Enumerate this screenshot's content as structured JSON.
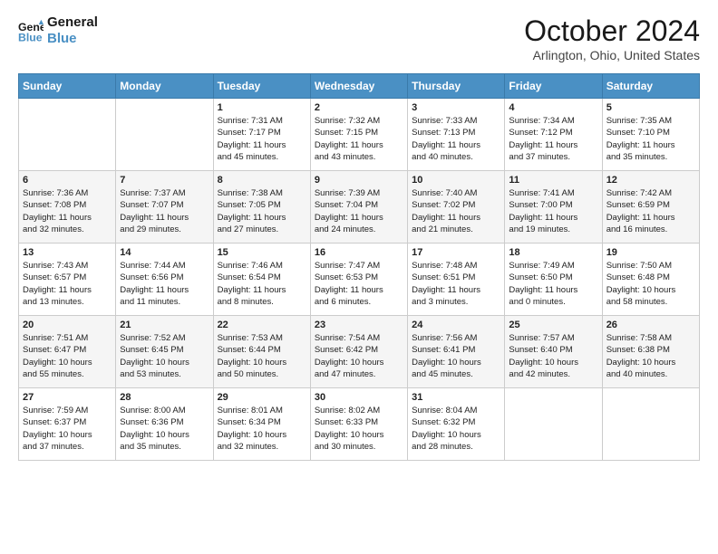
{
  "header": {
    "logo_line1": "General",
    "logo_line2": "Blue",
    "title": "October 2024",
    "location": "Arlington, Ohio, United States"
  },
  "days_of_week": [
    "Sunday",
    "Monday",
    "Tuesday",
    "Wednesday",
    "Thursday",
    "Friday",
    "Saturday"
  ],
  "weeks": [
    [
      {
        "day": "",
        "content": ""
      },
      {
        "day": "",
        "content": ""
      },
      {
        "day": "1",
        "content": "Sunrise: 7:31 AM\nSunset: 7:17 PM\nDaylight: 11 hours\nand 45 minutes."
      },
      {
        "day": "2",
        "content": "Sunrise: 7:32 AM\nSunset: 7:15 PM\nDaylight: 11 hours\nand 43 minutes."
      },
      {
        "day": "3",
        "content": "Sunrise: 7:33 AM\nSunset: 7:13 PM\nDaylight: 11 hours\nand 40 minutes."
      },
      {
        "day": "4",
        "content": "Sunrise: 7:34 AM\nSunset: 7:12 PM\nDaylight: 11 hours\nand 37 minutes."
      },
      {
        "day": "5",
        "content": "Sunrise: 7:35 AM\nSunset: 7:10 PM\nDaylight: 11 hours\nand 35 minutes."
      }
    ],
    [
      {
        "day": "6",
        "content": "Sunrise: 7:36 AM\nSunset: 7:08 PM\nDaylight: 11 hours\nand 32 minutes."
      },
      {
        "day": "7",
        "content": "Sunrise: 7:37 AM\nSunset: 7:07 PM\nDaylight: 11 hours\nand 29 minutes."
      },
      {
        "day": "8",
        "content": "Sunrise: 7:38 AM\nSunset: 7:05 PM\nDaylight: 11 hours\nand 27 minutes."
      },
      {
        "day": "9",
        "content": "Sunrise: 7:39 AM\nSunset: 7:04 PM\nDaylight: 11 hours\nand 24 minutes."
      },
      {
        "day": "10",
        "content": "Sunrise: 7:40 AM\nSunset: 7:02 PM\nDaylight: 11 hours\nand 21 minutes."
      },
      {
        "day": "11",
        "content": "Sunrise: 7:41 AM\nSunset: 7:00 PM\nDaylight: 11 hours\nand 19 minutes."
      },
      {
        "day": "12",
        "content": "Sunrise: 7:42 AM\nSunset: 6:59 PM\nDaylight: 11 hours\nand 16 minutes."
      }
    ],
    [
      {
        "day": "13",
        "content": "Sunrise: 7:43 AM\nSunset: 6:57 PM\nDaylight: 11 hours\nand 13 minutes."
      },
      {
        "day": "14",
        "content": "Sunrise: 7:44 AM\nSunset: 6:56 PM\nDaylight: 11 hours\nand 11 minutes."
      },
      {
        "day": "15",
        "content": "Sunrise: 7:46 AM\nSunset: 6:54 PM\nDaylight: 11 hours\nand 8 minutes."
      },
      {
        "day": "16",
        "content": "Sunrise: 7:47 AM\nSunset: 6:53 PM\nDaylight: 11 hours\nand 6 minutes."
      },
      {
        "day": "17",
        "content": "Sunrise: 7:48 AM\nSunset: 6:51 PM\nDaylight: 11 hours\nand 3 minutes."
      },
      {
        "day": "18",
        "content": "Sunrise: 7:49 AM\nSunset: 6:50 PM\nDaylight: 11 hours\nand 0 minutes."
      },
      {
        "day": "19",
        "content": "Sunrise: 7:50 AM\nSunset: 6:48 PM\nDaylight: 10 hours\nand 58 minutes."
      }
    ],
    [
      {
        "day": "20",
        "content": "Sunrise: 7:51 AM\nSunset: 6:47 PM\nDaylight: 10 hours\nand 55 minutes."
      },
      {
        "day": "21",
        "content": "Sunrise: 7:52 AM\nSunset: 6:45 PM\nDaylight: 10 hours\nand 53 minutes."
      },
      {
        "day": "22",
        "content": "Sunrise: 7:53 AM\nSunset: 6:44 PM\nDaylight: 10 hours\nand 50 minutes."
      },
      {
        "day": "23",
        "content": "Sunrise: 7:54 AM\nSunset: 6:42 PM\nDaylight: 10 hours\nand 47 minutes."
      },
      {
        "day": "24",
        "content": "Sunrise: 7:56 AM\nSunset: 6:41 PM\nDaylight: 10 hours\nand 45 minutes."
      },
      {
        "day": "25",
        "content": "Sunrise: 7:57 AM\nSunset: 6:40 PM\nDaylight: 10 hours\nand 42 minutes."
      },
      {
        "day": "26",
        "content": "Sunrise: 7:58 AM\nSunset: 6:38 PM\nDaylight: 10 hours\nand 40 minutes."
      }
    ],
    [
      {
        "day": "27",
        "content": "Sunrise: 7:59 AM\nSunset: 6:37 PM\nDaylight: 10 hours\nand 37 minutes."
      },
      {
        "day": "28",
        "content": "Sunrise: 8:00 AM\nSunset: 6:36 PM\nDaylight: 10 hours\nand 35 minutes."
      },
      {
        "day": "29",
        "content": "Sunrise: 8:01 AM\nSunset: 6:34 PM\nDaylight: 10 hours\nand 32 minutes."
      },
      {
        "day": "30",
        "content": "Sunrise: 8:02 AM\nSunset: 6:33 PM\nDaylight: 10 hours\nand 30 minutes."
      },
      {
        "day": "31",
        "content": "Sunrise: 8:04 AM\nSunset: 6:32 PM\nDaylight: 10 hours\nand 28 minutes."
      },
      {
        "day": "",
        "content": ""
      },
      {
        "day": "",
        "content": ""
      }
    ]
  ]
}
